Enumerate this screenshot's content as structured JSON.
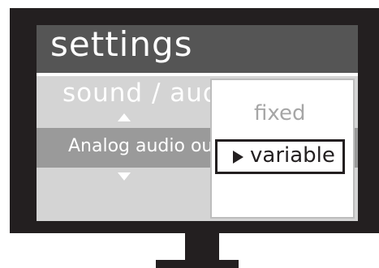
{
  "menu": {
    "title": "settings",
    "section": "sound / audio",
    "item_label": "Analog audio out"
  },
  "popup": {
    "options": [
      "fixed",
      "variable"
    ],
    "selected": "variable"
  },
  "colors": {
    "frame": "#231f20",
    "screen_bg": "#d4d4d4",
    "title_bar": "#555555",
    "item_bar": "#9a9a9a",
    "option_dim": "#a6a6a6"
  },
  "icons": {
    "scroll_up": "triangle-up-icon",
    "scroll_down": "triangle-down-icon",
    "selection_marker": "play-arrow-icon"
  }
}
